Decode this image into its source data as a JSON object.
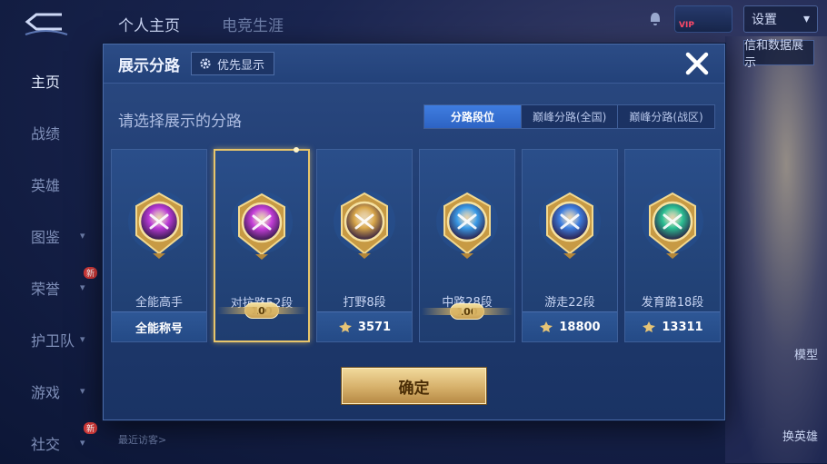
{
  "top_tabs": [
    "个人主页",
    "电竞生涯"
  ],
  "settings_label": "设置",
  "side_nav": [
    {
      "label": "主页",
      "active": true,
      "chevron": false,
      "new": false
    },
    {
      "label": "战绩",
      "active": false,
      "chevron": false,
      "new": false
    },
    {
      "label": "英雄",
      "active": false,
      "chevron": false,
      "new": false
    },
    {
      "label": "图鉴",
      "active": false,
      "chevron": true,
      "new": false
    },
    {
      "label": "荣誉",
      "active": false,
      "chevron": true,
      "new": true
    },
    {
      "label": "护卫队",
      "active": false,
      "chevron": true,
      "new": false
    },
    {
      "label": "游戏",
      "active": false,
      "chevron": true,
      "new": false
    },
    {
      "label": "社交",
      "active": false,
      "chevron": true,
      "new": true
    }
  ],
  "new_tag": "新",
  "vip_label": "VIP",
  "right_peek_label": "信和数据展示",
  "model_label": "模型",
  "swap_hero_label": "换英雄",
  "visitors_label": "最近访客>",
  "modal": {
    "title": "展示分路",
    "priority_label": "优先显示",
    "subtitle": "请选择展示的分路",
    "segments": [
      "分路段位",
      "巅峰分路(全国)",
      "巅峰分路(战区)"
    ],
    "active_segment": 0,
    "confirm_label": "确定",
    "cards": [
      {
        "name": "全能高手",
        "foot": "全能称号",
        "foot_type": "text",
        "selected": false,
        "emblem": "all-round-emblem",
        "color": "#b93ad6"
      },
      {
        "name": "对抗路52段",
        "foot": "100",
        "foot_type": "badge",
        "selected": true,
        "emblem": "clash-lane-emblem",
        "color": "#c43ed8"
      },
      {
        "name": "打野8段",
        "foot": "3571",
        "foot_type": "score",
        "selected": false,
        "emblem": "jungle-emblem",
        "color": "#d8a64a"
      },
      {
        "name": "中路28段",
        "foot": "100",
        "foot_type": "badge",
        "selected": false,
        "emblem": "mid-lane-emblem",
        "color": "#3a9be8"
      },
      {
        "name": "游走22段",
        "foot": "18800",
        "foot_type": "score",
        "selected": false,
        "emblem": "roam-emblem",
        "color": "#3d7ee0"
      },
      {
        "name": "发育路18段",
        "foot": "13311",
        "foot_type": "score",
        "selected": false,
        "emblem": "farm-lane-emblem",
        "color": "#2bbf93"
      }
    ]
  }
}
